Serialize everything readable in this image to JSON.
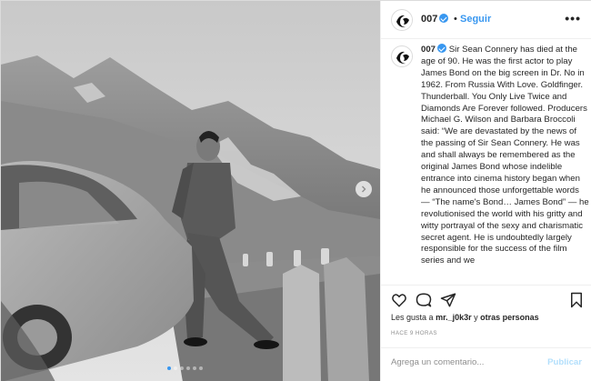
{
  "account": {
    "username": "007",
    "separator": "•",
    "follow_label": "Seguir",
    "more_label": "•••"
  },
  "caption": {
    "username": "007",
    "text": "Sir Sean Connery has died at the age of 90. He was the first actor to play James Bond on the big screen in Dr. No in 1962. From Russia With Love. Goldfinger. Thunderball. You Only Live Twice and Diamonds Are Forever followed. Producers Michael G. Wilson and Barbara Broccoli said: “We are devastated by the news of the passing of Sir Sean Connery. He was and shall always be remembered as the original James Bond whose indelible entrance into cinema history began when he announced those unforgettable words — “The name's Bond… James Bond” — he revolutionised the world with his gritty and witty portrayal of the sexy and charismatic secret agent. He is undoubtedly largely responsible for the success of the film series and we"
  },
  "likes": {
    "prefix": "Les gusta a",
    "user": "mr._j0k3r",
    "middle": "y",
    "others": "otras personas"
  },
  "timestamp": "HACE 9 HORAS",
  "comment": {
    "placeholder": "Agrega un comentario...",
    "publish_label": "Publicar"
  },
  "carousel": {
    "slide_count": 6,
    "active_index": 0
  },
  "icons": {
    "like": "heart-icon",
    "comment": "comment-icon",
    "share": "share-icon",
    "save": "bookmark-icon",
    "verified": "verified-badge-icon",
    "next": "chevron-right-icon"
  },
  "colors": {
    "accent": "#3897f0",
    "publish_disabled": "#b2dffc",
    "secondary_text": "#8e8e8e"
  }
}
